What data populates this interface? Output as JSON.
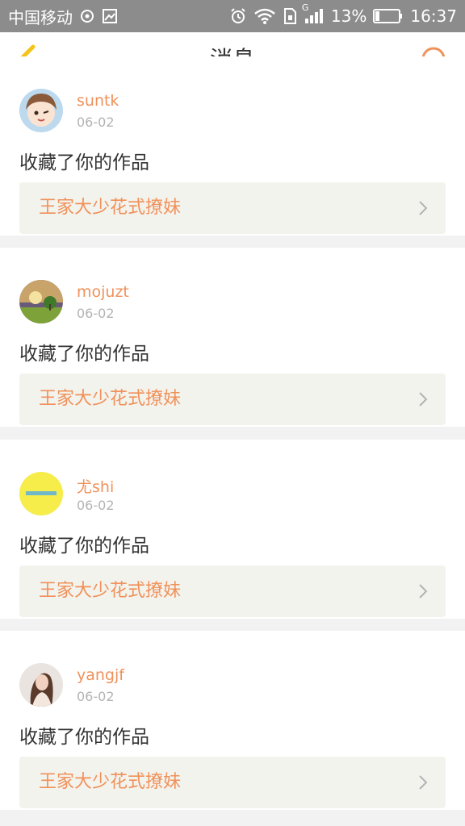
{
  "status_bar": {
    "carrier": "中国移动",
    "network_type": "G",
    "battery_percent": "13%",
    "time": "16:37"
  },
  "header": {
    "title": "消息",
    "back_icon": "chevron-left-icon",
    "search_icon": "search-icon"
  },
  "colors": {
    "accent": "#f0915a",
    "back_icon": "#f5c41a",
    "status_bar_bg": "#8c8c8c"
  },
  "notifications": [
    {
      "username": "suntk",
      "date": "06-02",
      "action": "收藏了你的作品",
      "work_title": "王家大少花式撩妹",
      "avatar": "anime-girl-avatar"
    },
    {
      "username": "mojuzt",
      "date": "06-02",
      "action": "收藏了你的作品",
      "work_title": "王家大少花式撩妹",
      "avatar": "landscape-tree-avatar"
    },
    {
      "username": "尤shi",
      "date": "06-02",
      "action": "收藏了你的作品",
      "work_title": "王家大少花式撩妹",
      "avatar": "yellow-circle-avatar"
    },
    {
      "username": "yangjf",
      "date": "06-02",
      "action": "收藏了你的作品",
      "work_title": "王家大少花式撩妹",
      "avatar": "portrait-photo-avatar"
    }
  ]
}
